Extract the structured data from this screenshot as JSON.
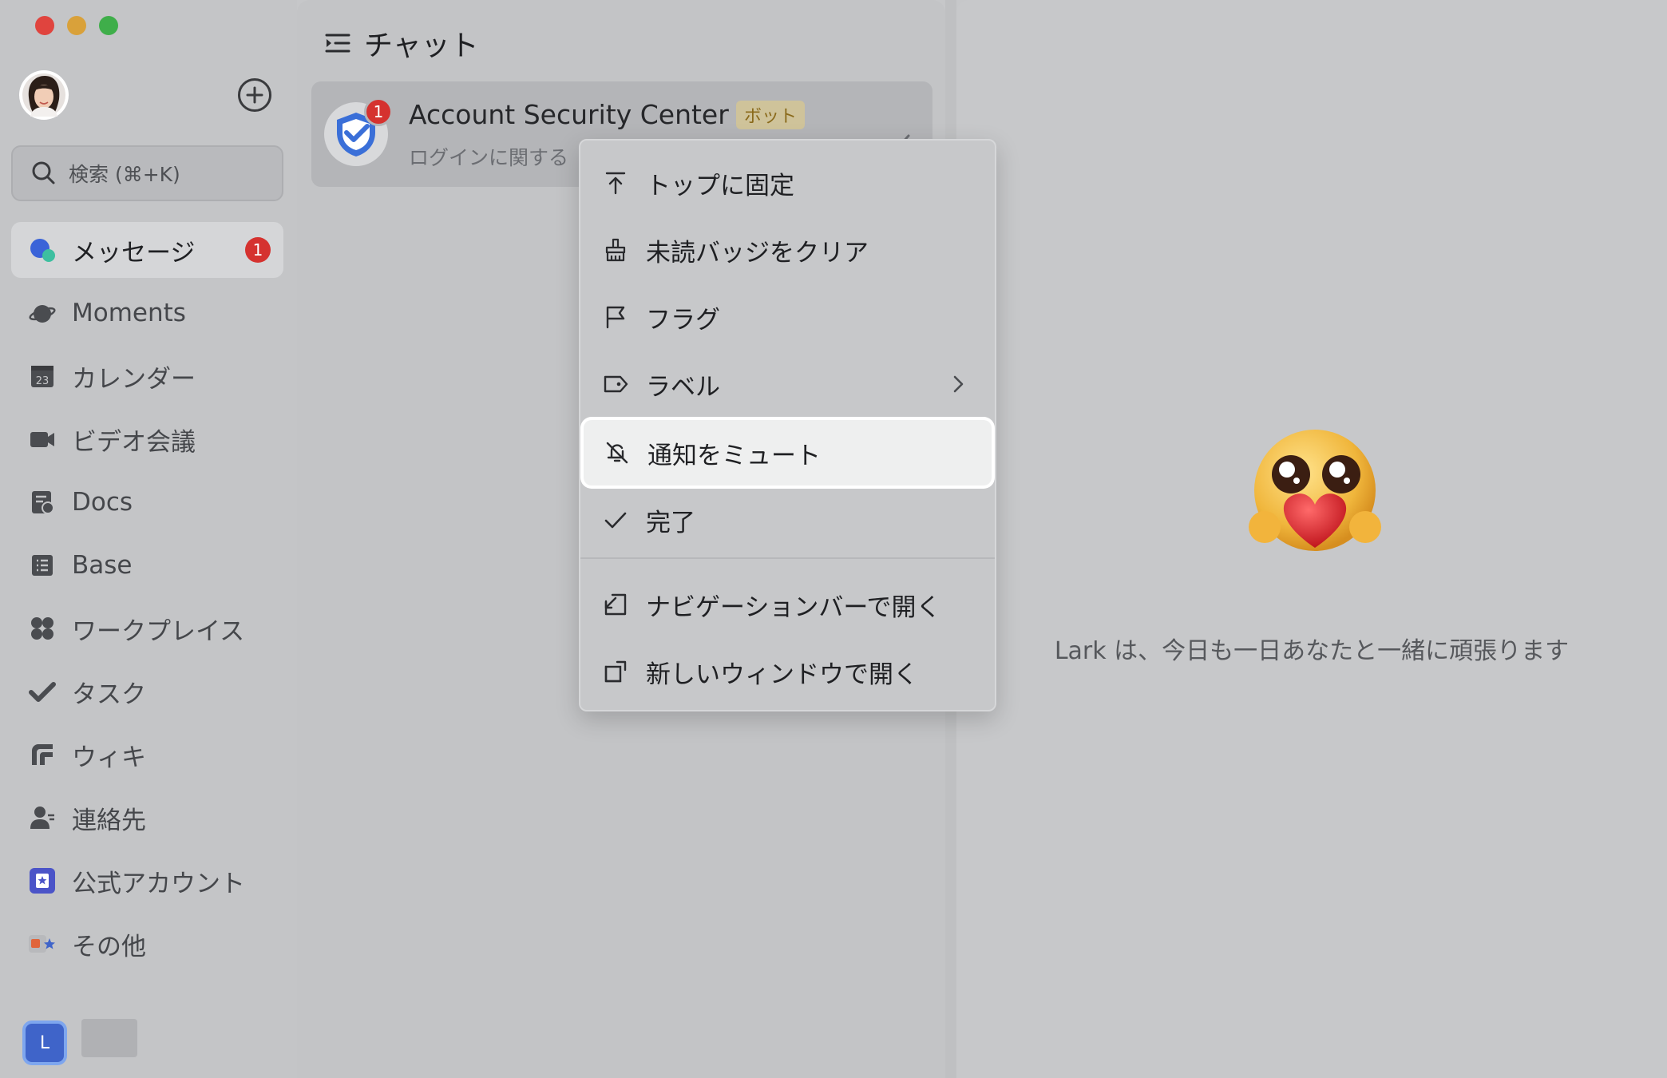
{
  "sidebar": {
    "search_placeholder": "検索 (⌘+K)",
    "items": [
      {
        "label": "メッセージ",
        "icon": "message-icon",
        "badge": "1"
      },
      {
        "label": "Moments",
        "icon": "moments-icon"
      },
      {
        "label": "カレンダー",
        "icon": "calendar-icon",
        "icon_text": "23"
      },
      {
        "label": "ビデオ会議",
        "icon": "video-icon"
      },
      {
        "label": "Docs",
        "icon": "docs-icon"
      },
      {
        "label": "Base",
        "icon": "base-icon"
      },
      {
        "label": "ワークプレイス",
        "icon": "workplace-icon"
      },
      {
        "label": "タスク",
        "icon": "task-icon"
      },
      {
        "label": "ウィキ",
        "icon": "wiki-icon"
      },
      {
        "label": "連絡先",
        "icon": "contacts-icon"
      },
      {
        "label": "公式アカウント",
        "icon": "official-account-icon"
      },
      {
        "label": "その他",
        "icon": "more-icon"
      }
    ],
    "workspace_initial": "L"
  },
  "chat_list": {
    "title": "チャット",
    "chat": {
      "name": "Account Security Center",
      "tag": "ボット",
      "preview": "ログインに関する",
      "badge": "1"
    }
  },
  "context_menu": {
    "items": [
      {
        "label": "トップに固定",
        "icon": "pin-top-icon"
      },
      {
        "label": "未読バッジをクリア",
        "icon": "broom-icon"
      },
      {
        "label": "フラグ",
        "icon": "flag-icon"
      },
      {
        "label": "ラベル",
        "icon": "label-icon"
      },
      {
        "label": "通知をミュート",
        "icon": "bell-off-icon"
      },
      {
        "label": "完了",
        "icon": "check-icon"
      },
      {
        "label": "ナビゲーションバーで開く",
        "icon": "open-nav-icon"
      },
      {
        "label": "新しいウィンドウで開く",
        "icon": "new-window-icon"
      }
    ],
    "highlighted_index": 4
  },
  "right_panel": {
    "slogan": "Lark は、今日も一日あなたと一緒に頑張ります"
  },
  "colors": {
    "badge_red": "#d5322f",
    "accent_blue": "#3f64c9",
    "bot_tag_text": "#8a6a1b"
  }
}
